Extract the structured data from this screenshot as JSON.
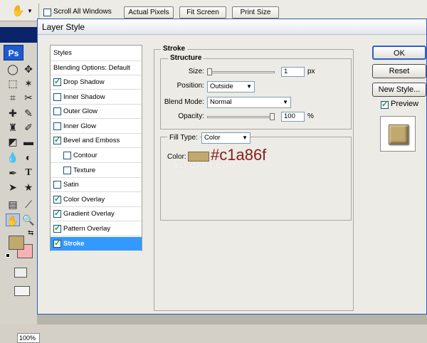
{
  "toolbar": {
    "scroll_all_windows": "Scroll All Windows",
    "actual_pixels": "Actual Pixels",
    "fit_screen": "Fit Screen",
    "print_size": "Print Size"
  },
  "tools": {
    "logo": "Ps",
    "zoom": "100%"
  },
  "dialog": {
    "title": "Layer Style",
    "styles_header": "Styles",
    "blending_options": "Blending Options: Default",
    "effects": [
      {
        "label": "Drop Shadow",
        "checked": true
      },
      {
        "label": "Inner Shadow",
        "checked": false
      },
      {
        "label": "Outer Glow",
        "checked": false
      },
      {
        "label": "Inner Glow",
        "checked": false
      },
      {
        "label": "Bevel and Emboss",
        "checked": true
      },
      {
        "label": "Contour",
        "checked": false
      },
      {
        "label": "Texture",
        "checked": false
      },
      {
        "label": "Satin",
        "checked": false
      },
      {
        "label": "Color Overlay",
        "checked": true
      },
      {
        "label": "Gradient Overlay",
        "checked": true
      },
      {
        "label": "Pattern Overlay",
        "checked": true
      },
      {
        "label": "Stroke",
        "checked": true
      }
    ],
    "stroke": {
      "section_title": "Stroke",
      "structure_title": "Structure",
      "size_label": "Size:",
      "size_value": "1",
      "size_unit": "px",
      "position_label": "Position:",
      "position_value": "Outside",
      "blend_mode_label": "Blend Mode:",
      "blend_mode_value": "Normal",
      "opacity_label": "Opacity:",
      "opacity_value": "100",
      "opacity_unit": "%",
      "opacity_fraction": 1.0,
      "size_fraction": 0.0,
      "fill_type_label": "Fill Type:",
      "fill_type_value": "Color",
      "color_label": "Color:",
      "color_hex_annotation": "#c1a86f",
      "color_value": "#c1a86f",
      "watermark": "ALFOART.COM"
    },
    "buttons": {
      "ok": "OK",
      "reset": "Reset",
      "new_style": "New Style...",
      "preview": "Preview"
    }
  },
  "colors": {
    "foreground": "#c1a86f",
    "background": "#f7b3b3",
    "selection": "#3399ff",
    "annotation": "#8b1a1a"
  }
}
